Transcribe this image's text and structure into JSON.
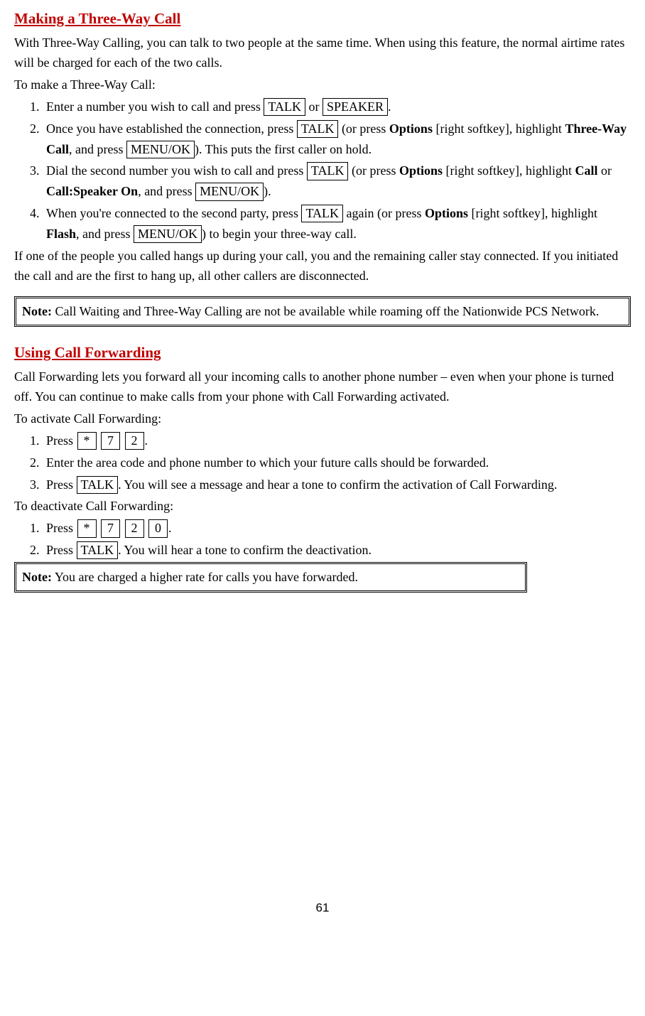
{
  "section1": {
    "heading": "Making a Three-Way Call",
    "intro": "With Three-Way Calling, you can talk to two people at the same time. When using this feature, the normal airtime rates will be charged for each of the two calls.",
    "lead": "To make a Three-Way Call:",
    "steps": {
      "s1": {
        "t1": "Enter a number you wish to call and press ",
        "key1": "TALK",
        "t2": " or ",
        "key2": "SPEAKER",
        "t3": "."
      },
      "s2": {
        "t1": "Once you have established the connection, press ",
        "key1": "TALK",
        "t2": " (or press ",
        "b1": "Options",
        "t3": " [right softkey], highlight ",
        "b2": "Three-Way Call",
        "t4": ", and press ",
        "key2": "MENU/OK",
        "t5": "). This puts the first caller on hold."
      },
      "s3": {
        "t1": "Dial the second number you wish to call and press ",
        "key1": "TALK",
        "t2": " (or press ",
        "b1": "Options",
        "t3": " [right softkey], highlight ",
        "b2": "Call",
        "t4": " or ",
        "b3": "Call:Speaker On",
        "t5": ", and press ",
        "key2": "MENU/OK",
        "t6": ")."
      },
      "s4": {
        "t1": "When you're connected to the second party, press ",
        "key1": "TALK",
        "t2": " again (or press ",
        "b1": "Options",
        "t3": " [right softkey], highlight ",
        "b2": "Flash",
        "t4": ", and press ",
        "key2": "MENU/OK",
        "t5": ") to begin your three-way call."
      }
    },
    "outro": "If one of the people you called hangs up during your call, you and the remaining caller stay connected. If you initiated the call and are the first to hang up, all other callers are disconnected.",
    "note": {
      "label": "Note:",
      "text": " Call Waiting and Three-Way Calling are not be available while roaming off the Nationwide PCS Network."
    }
  },
  "section2": {
    "heading": "Using Call Forwarding",
    "intro": "Call Forwarding lets you forward all your incoming calls to another phone number – even when your phone is turned off. You can continue to make calls from your phone with Call Forwarding activated.",
    "lead1": "To activate Call Forwarding:",
    "activate": {
      "s1": {
        "t1": "Press ",
        "k1": " * ",
        "k2": " 7 ",
        "k3": " 2 ",
        "t2": "."
      },
      "s2": "Enter the area code and phone number to which your future calls should be forwarded.",
      "s3": {
        "t1": "Press ",
        "key1": "TALK",
        "t2": ". You will see a message and hear a tone to confirm the activation of Call Forwarding."
      }
    },
    "lead2": "To deactivate Call Forwarding:",
    "deactivate": {
      "s1": {
        "t1": "Press ",
        "k1": " * ",
        "k2": " 7 ",
        "k3": " 2 ",
        "k4": " 0 ",
        "t2": "."
      },
      "s2": {
        "t1": "Press ",
        "key1": "TALK",
        "t2": ". You will hear a tone to confirm the deactivation."
      }
    },
    "note": {
      "label": "Note:",
      "text": " You are charged a higher rate for calls you have forwarded."
    }
  },
  "page": "61"
}
